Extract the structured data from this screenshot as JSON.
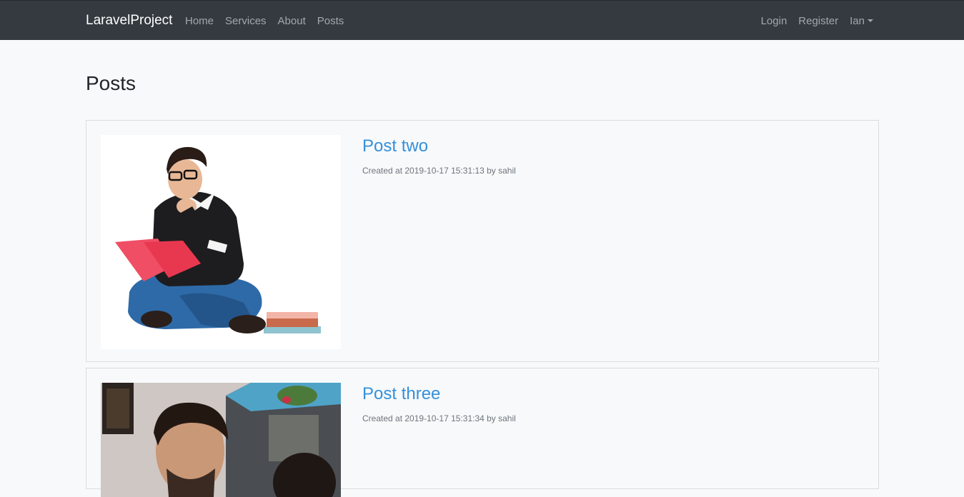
{
  "navbar": {
    "brand": "LaravelProject",
    "left_links": [
      "Home",
      "Services",
      "About",
      "Posts"
    ],
    "right_links": [
      "Login",
      "Register"
    ],
    "user_menu": "Ian"
  },
  "page": {
    "title": "Posts"
  },
  "posts": [
    {
      "title": "Post two",
      "meta": "Created at 2019-10-17 15:31:13 by sahil",
      "image": "man-reading-book-illustration"
    },
    {
      "title": "Post three",
      "meta": "Created at 2019-10-17 15:31:34 by sahil",
      "image": "selfie-photo"
    }
  ],
  "colors": {
    "navbar_bg": "#343a40",
    "link_blue": "#3490dc",
    "page_bg": "#f8f9fa"
  }
}
